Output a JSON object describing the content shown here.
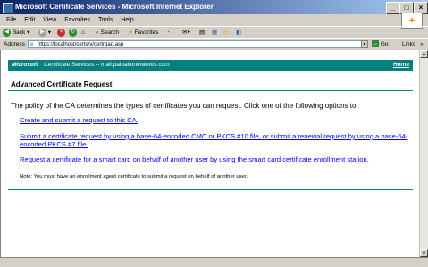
{
  "window": {
    "title": "Microsoft Certificate Services - Microsoft Internet Explorer"
  },
  "menu": [
    "File",
    "Edit",
    "View",
    "Favorites",
    "Tools",
    "Help"
  ],
  "toolbar": {
    "back": "Back",
    "search": "Search",
    "favorites": "Favorites"
  },
  "address": {
    "label": "Address",
    "url": "https://localhost/certsrv/certrqad.asp",
    "go": "Go",
    "links": "Links"
  },
  "page": {
    "brand_ms": "Microsoft",
    "brand_service": "Certificate Services  --  mail.paloaltonetworks.com",
    "home": "Home",
    "title": "Advanced Certificate Request",
    "policy_text": "The policy of the CA determines the types of certificates you can request. Click one of the following options to:",
    "options": [
      "Create and submit a request to this CA.",
      "Submit a certificate request by using a base-64-encoded CMC or PKCS #10 file, or submit a renewal request by using a base-64-encoded PKCS #7 file.",
      "Request a certificate for a smart card on behalf of another user by using the smart card certificate enrollment station."
    ],
    "note": "Note: You must have an enrollment agent certificate to submit a request on behalf of another user."
  }
}
